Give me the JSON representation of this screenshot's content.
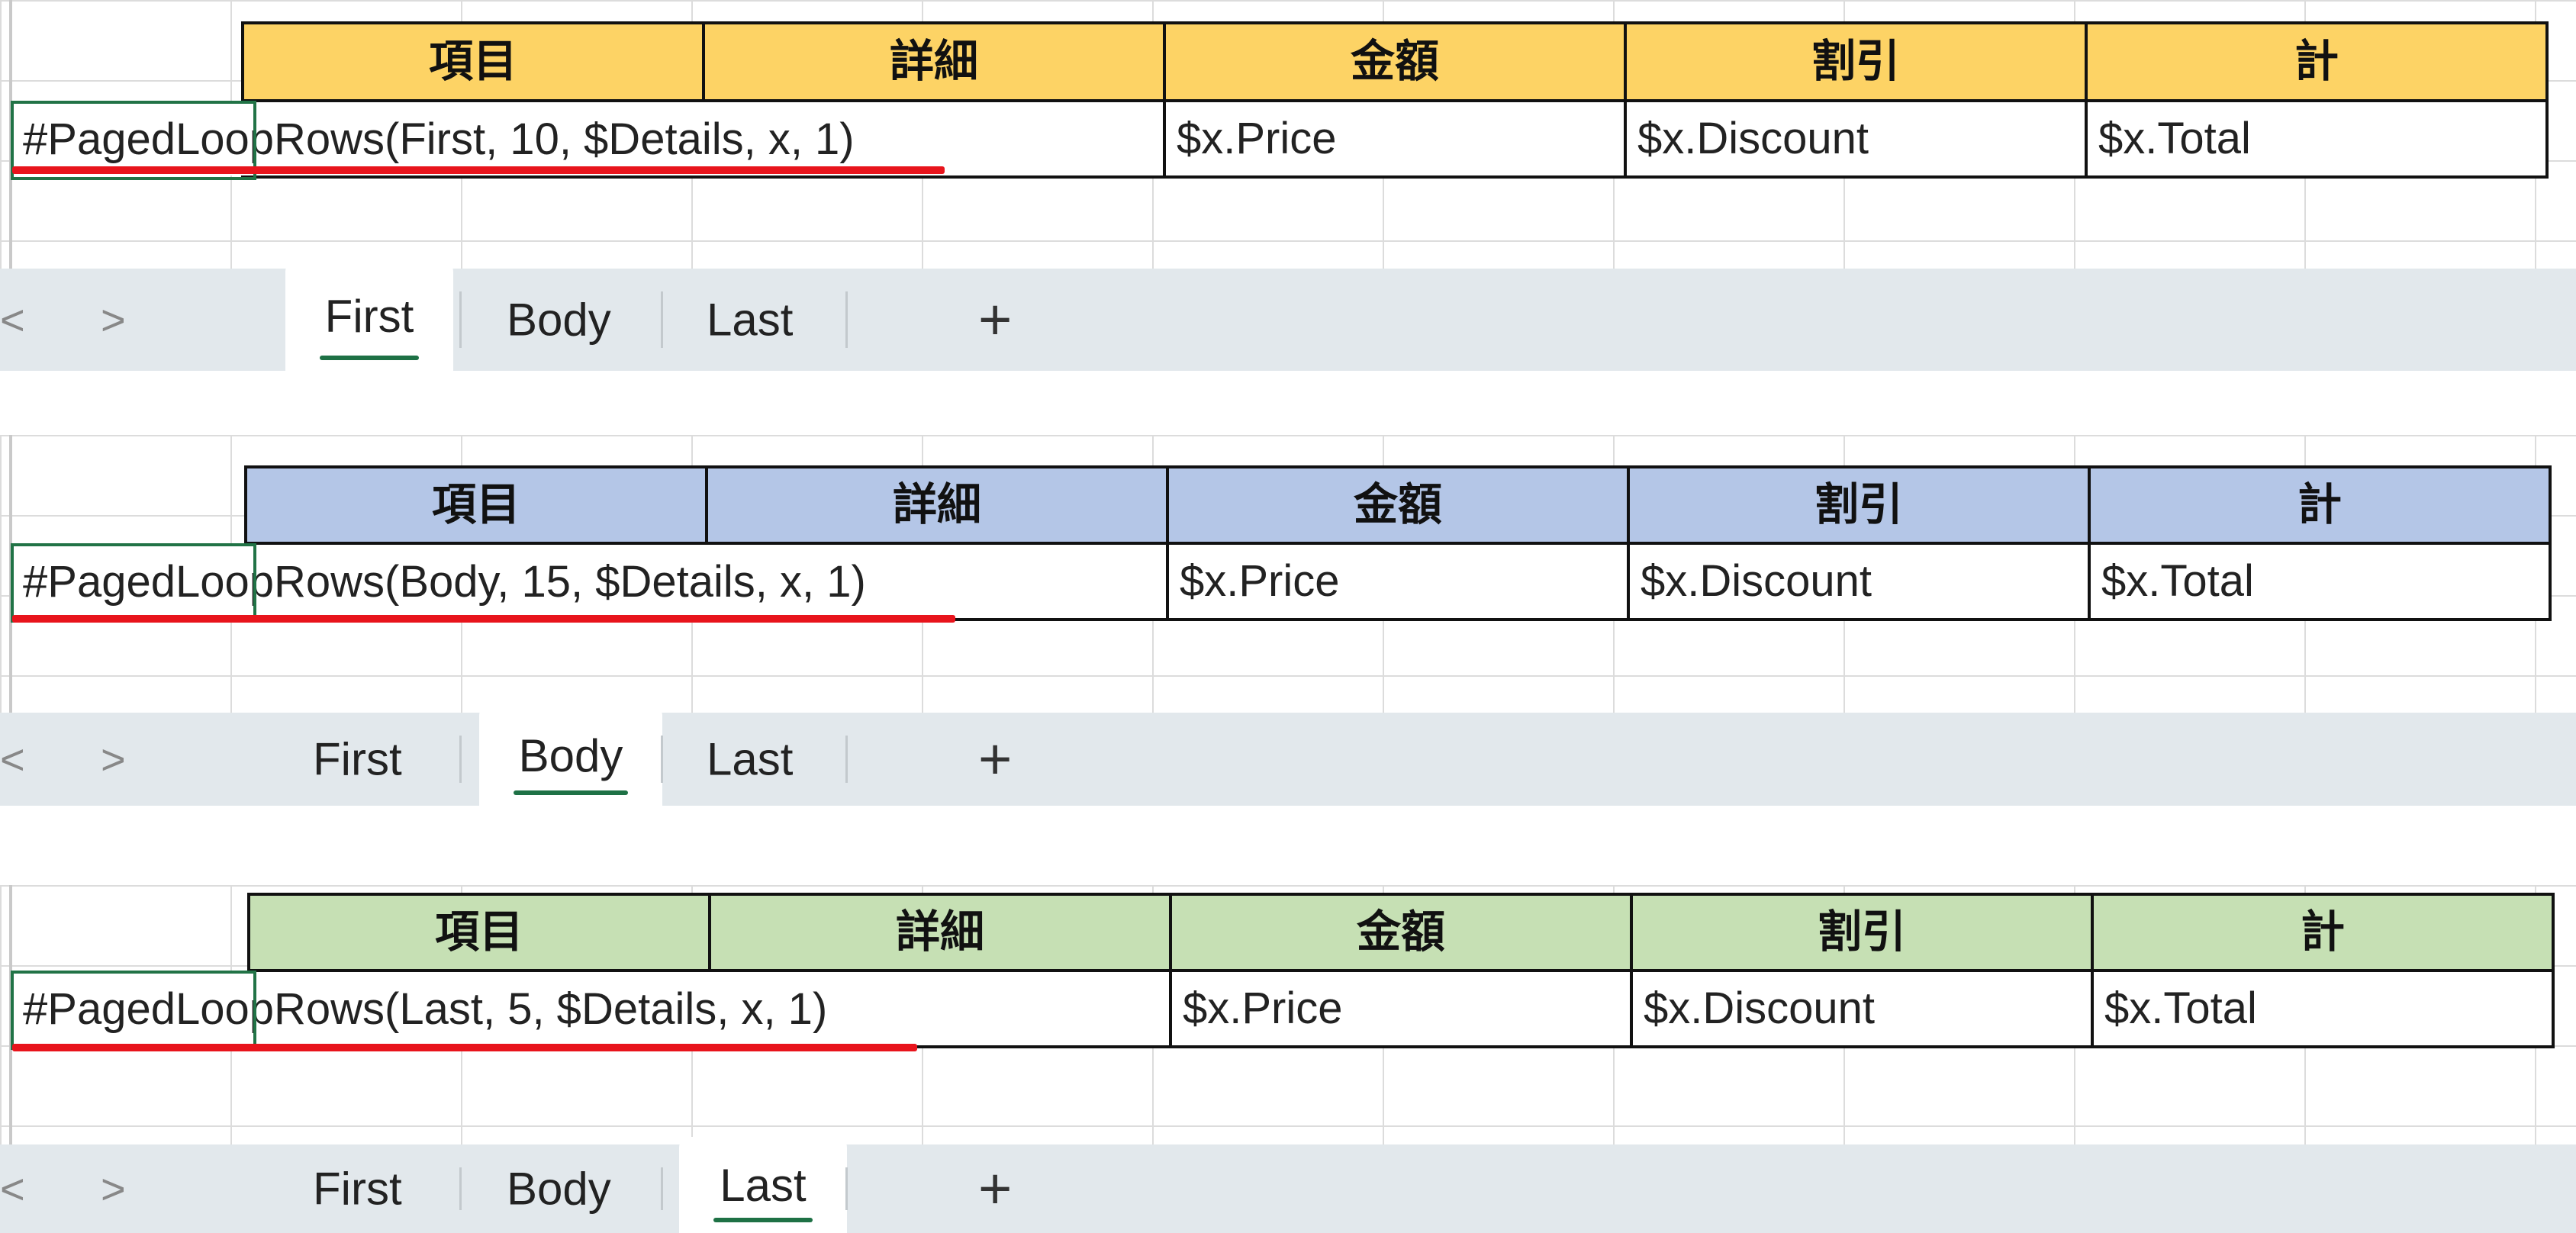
{
  "columns": [
    "項目",
    "詳細",
    "金額",
    "割引",
    "計"
  ],
  "row_cells": [
    "$x.Price",
    "$x.Discount",
    "$x.Total"
  ],
  "tab_labels": [
    "First",
    "Body",
    "Last"
  ],
  "add_sheet_label": "+",
  "nav_prev": "<",
  "nav_next": ">",
  "colors": {
    "first_header": "#fdd365",
    "body_header": "#b4c6e7",
    "last_header": "#c6e0b4",
    "underline": "#e8141c",
    "selection": "#217346",
    "tabbar": "#e2e8ec"
  },
  "panels": [
    {
      "formula": "#PagedLoopRows(First, 10, $Details, x, 1)",
      "active_tab": "First"
    },
    {
      "formula": "#PagedLoopRows(Body, 15, $Details, x, 1)",
      "active_tab": "Body"
    },
    {
      "formula": "#PagedLoopRows(Last, 5, $Details, x, 1)",
      "active_tab": "Last"
    }
  ]
}
